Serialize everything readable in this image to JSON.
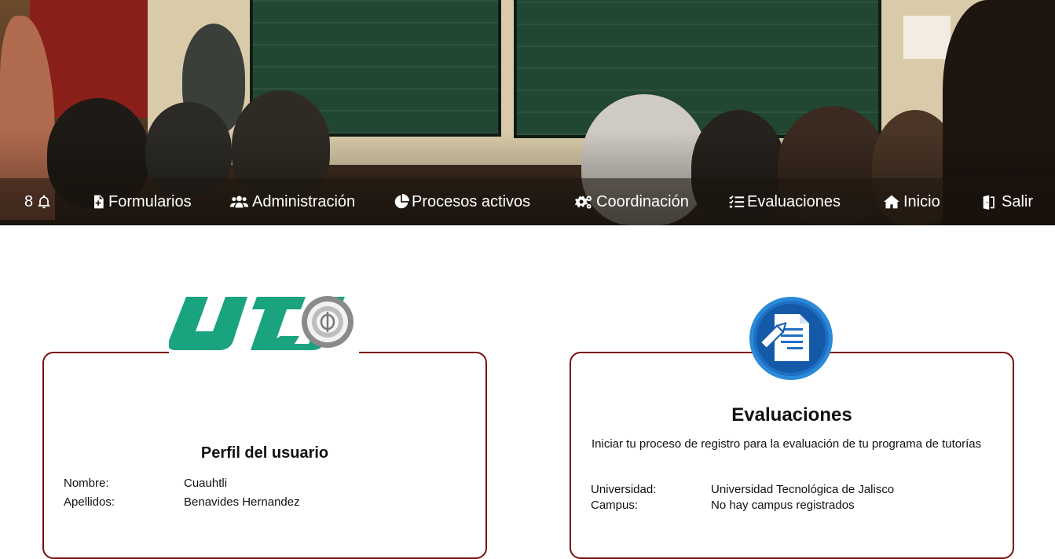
{
  "nav": {
    "notifications_count": "8",
    "items": [
      {
        "label": "Formularios",
        "icon": "file-plus-icon"
      },
      {
        "label": "Administración",
        "icon": "users-cog-icon"
      },
      {
        "label": "Procesos activos",
        "icon": "pie-chart-icon"
      },
      {
        "label": "Coordinación",
        "icon": "cogs-icon"
      },
      {
        "label": "Evaluaciones",
        "icon": "tasks-icon"
      },
      {
        "label": "Inicio",
        "icon": "home-icon"
      },
      {
        "label": "Salir",
        "icon": "door-exit-icon"
      }
    ]
  },
  "profile_card": {
    "logo_text": "UTJ",
    "title": "Perfil del usuario",
    "fields": [
      {
        "label": "Nombre:",
        "value": "Cuauhtli"
      },
      {
        "label": "Apellidos:",
        "value": "Benavides Hernandez"
      }
    ]
  },
  "evaluations_card": {
    "icon": "document-pencil-icon",
    "title": "Evaluaciones",
    "description": "Iniciar tu proceso de registro para la evaluación de tu programa de tutorías",
    "fields": [
      {
        "label": "Universidad:",
        "value": "Universidad Tecnológica de Jalisco"
      },
      {
        "label": "Campus:",
        "value": "No hay campus registrados"
      }
    ]
  },
  "colors": {
    "card_border": "#7a1010",
    "utj_green": "#1aa37f",
    "eval_icon_blue": "#1f6fc4"
  }
}
